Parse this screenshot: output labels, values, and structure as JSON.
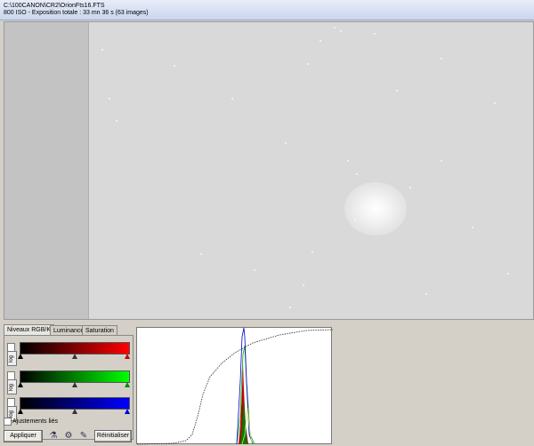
{
  "header": {
    "line1": "C:\\100CANON\\CR2\\OrionFts16.FTS",
    "line2": "800 ISO - Exposition totale : 33 mn 36 s (63 images)"
  },
  "tabs": [
    "Niveaux RGB/K",
    "Luminance",
    "Saturation"
  ],
  "channels": [
    {
      "name": "red",
      "color": "#ff0000",
      "log_label": "log"
    },
    {
      "name": "green",
      "color": "#00ff00",
      "log_label": "log"
    },
    {
      "name": "blue",
      "color": "#0000ff",
      "log_label": "log"
    }
  ],
  "linked_label": "Ajustements liés",
  "buttons": {
    "apply": "Appliquer",
    "reset": "Réinitialiser"
  },
  "icons": [
    "curves-icon",
    "settings-icon",
    "color-picker-icon"
  ]
}
